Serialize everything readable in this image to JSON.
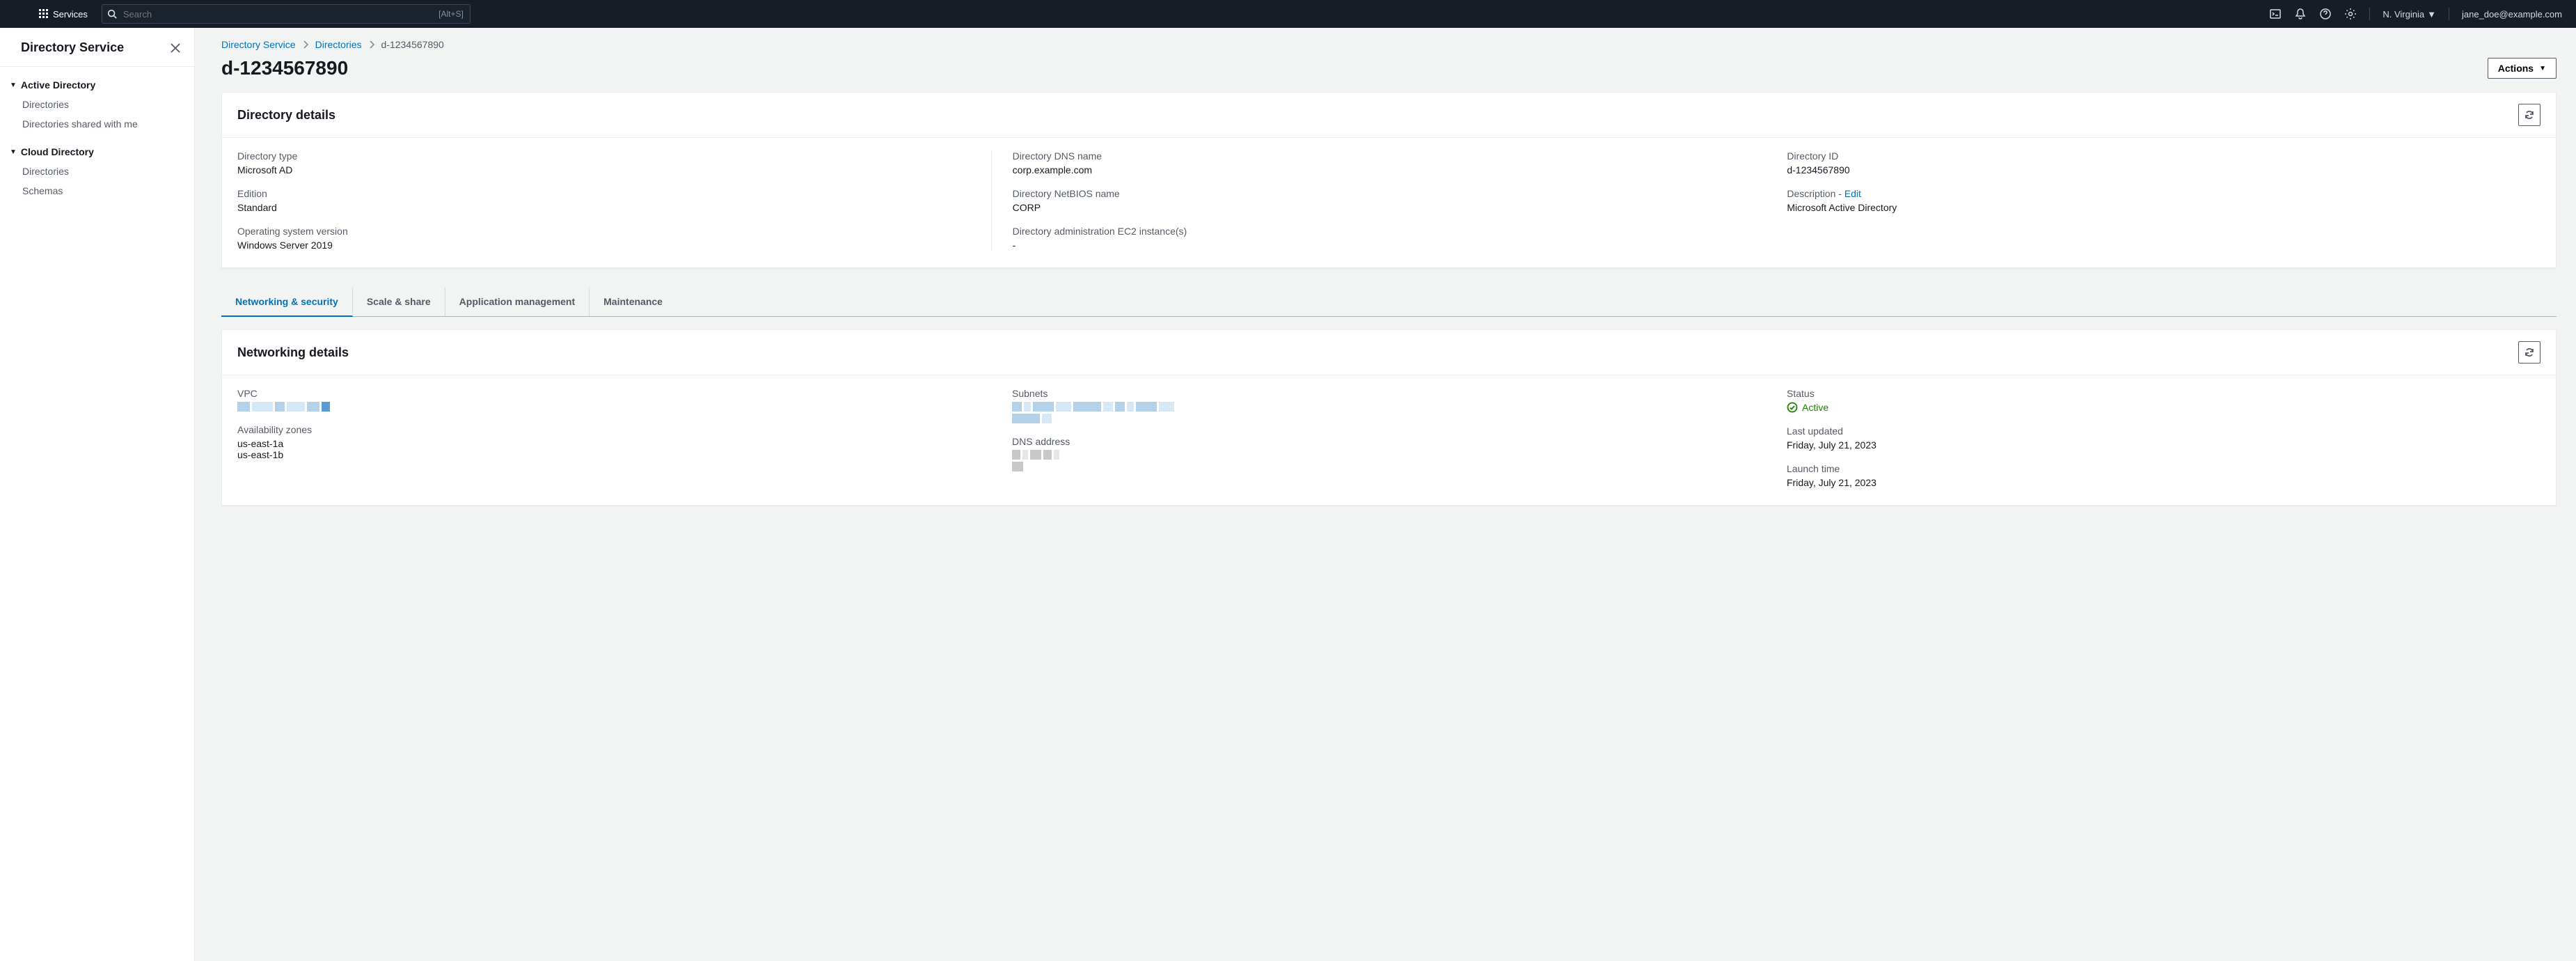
{
  "nav": {
    "services_label": "Services",
    "search_placeholder": "Search",
    "search_shortcut": "[Alt+S]",
    "region": "N. Virginia",
    "username": "jane_doe@example.com"
  },
  "sidebar": {
    "title": "Directory Service",
    "sections": [
      {
        "heading": "Active Directory",
        "items": [
          "Directories",
          "Directories shared with me"
        ]
      },
      {
        "heading": "Cloud Directory",
        "items": [
          "Directories",
          "Schemas"
        ]
      }
    ]
  },
  "breadcrumbs": {
    "root": "Directory Service",
    "level1": "Directories",
    "current": "d-1234567890"
  },
  "page": {
    "title": "d-1234567890",
    "actions_label": "Actions"
  },
  "directory_details": {
    "panel_title": "Directory details",
    "col1": {
      "directory_type_label": "Directory type",
      "directory_type_value": "Microsoft AD",
      "edition_label": "Edition",
      "edition_value": "Standard",
      "os_label": "Operating system version",
      "os_value": "Windows Server 2019"
    },
    "col2": {
      "dns_name_label": "Directory DNS name",
      "dns_name_value": "corp.example.com",
      "netbios_label": "Directory NetBIOS name",
      "netbios_value": "CORP",
      "ec2_label": "Directory administration EC2 instance(s)",
      "ec2_value": "-"
    },
    "col3": {
      "id_label": "Directory ID",
      "id_value": "d-1234567890",
      "desc_label": "Description - ",
      "desc_edit": "Edit",
      "desc_value": "Microsoft Active Directory"
    }
  },
  "tabs": {
    "t1": "Networking & security",
    "t2": "Scale & share",
    "t3": "Application management",
    "t4": "Maintenance"
  },
  "networking_details": {
    "panel_title": "Networking details",
    "vpc_label": "VPC",
    "az_label": "Availability zones",
    "az_value1": "us-east-1a",
    "az_value2": "us-east-1b",
    "subnets_label": "Subnets",
    "dns_addr_label": "DNS address",
    "status_label": "Status",
    "status_value": "Active",
    "last_updated_label": "Last updated",
    "last_updated_value": "Friday, July 21, 2023",
    "launch_time_label": "Launch time",
    "launch_time_value": "Friday, July 21, 2023"
  }
}
